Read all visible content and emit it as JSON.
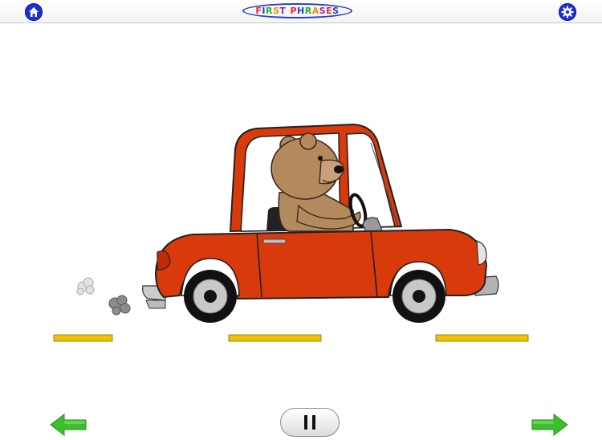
{
  "header": {
    "title_letters": [
      {
        "ch": "F",
        "color": "#e8262b"
      },
      {
        "ch": "I",
        "color": "#1f3fd6"
      },
      {
        "ch": "R",
        "color": "#2ea83a"
      },
      {
        "ch": "S",
        "color": "#f08a12"
      },
      {
        "ch": "T",
        "color": "#8a2bc9"
      },
      {
        "ch": " ",
        "color": "#000000"
      },
      {
        "ch": "P",
        "color": "#e8262b"
      },
      {
        "ch": "H",
        "color": "#1f3fd6"
      },
      {
        "ch": "R",
        "color": "#2ea83a"
      },
      {
        "ch": "A",
        "color": "#f08a12"
      },
      {
        "ch": "S",
        "color": "#8a2bc9"
      },
      {
        "ch": "E",
        "color": "#e8262b"
      },
      {
        "ch": "S",
        "color": "#1f3fd6"
      }
    ],
    "home_icon": "home-icon",
    "settings_icon": "gear-icon"
  },
  "scene": {
    "subject": "bear-driving-car",
    "car_color": "#d93a0c",
    "road_line_color": "#f2c200"
  },
  "controls": {
    "prev_icon": "arrow-left-icon",
    "pause_icon": "pause-icon",
    "next_icon": "arrow-right-icon",
    "arrow_color": "#3cbf2e"
  }
}
